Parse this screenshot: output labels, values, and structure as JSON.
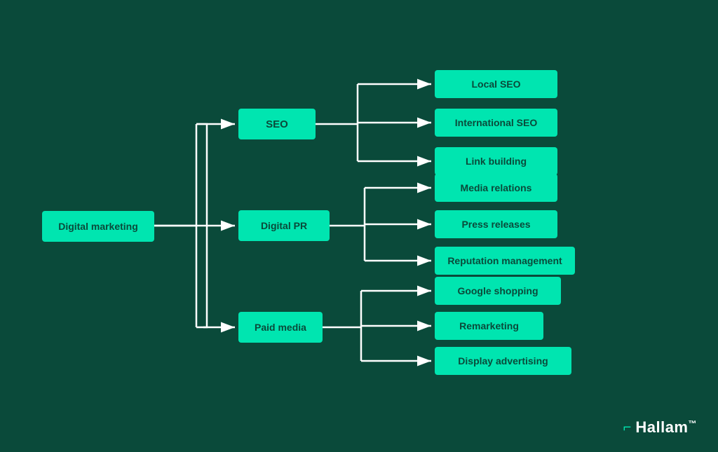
{
  "background": "#0a4a3a",
  "accent": "#00e5b0",
  "nodes": {
    "root": "Digital marketing",
    "level1": {
      "seo": "SEO",
      "pr": "Digital PR",
      "paid": "Paid media"
    },
    "level2": {
      "seo": [
        "Local SEO",
        "International SEO",
        "Link building"
      ],
      "pr": [
        "Media relations",
        "Press releases",
        "Reputation management"
      ],
      "paid": [
        "Google shopping",
        "Remarketing",
        "Display advertising"
      ]
    }
  },
  "logo": {
    "icon": "⌐",
    "text": "Hallam",
    "trademark": "™"
  }
}
